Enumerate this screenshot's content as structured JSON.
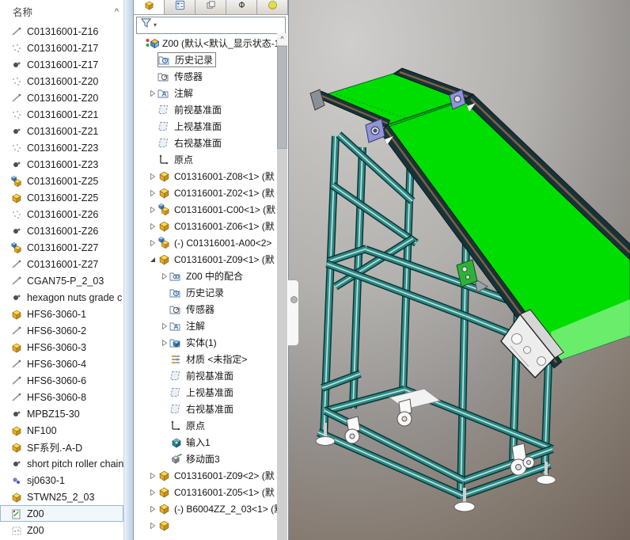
{
  "left_panel": {
    "header": "名称",
    "collapse_glyph": "^",
    "items": [
      {
        "label": "C01316001-Z16",
        "icon": "pin",
        "selected": false
      },
      {
        "label": "C01316001-Z17",
        "icon": "sketch",
        "selected": false
      },
      {
        "label": "C01316001-Z17",
        "icon": "dark",
        "selected": false
      },
      {
        "label": "C01316001-Z20",
        "icon": "sketch",
        "selected": false
      },
      {
        "label": "C01316001-Z20",
        "icon": "pin",
        "selected": false
      },
      {
        "label": "C01316001-Z21",
        "icon": "sketch",
        "selected": false
      },
      {
        "label": "C01316001-Z21",
        "icon": "dark",
        "selected": false
      },
      {
        "label": "C01316001-Z23",
        "icon": "sketch",
        "selected": false
      },
      {
        "label": "C01316001-Z23",
        "icon": "dark",
        "selected": false
      },
      {
        "label": "C01316001-Z25",
        "icon": "asm",
        "selected": false
      },
      {
        "label": "C01316001-Z25",
        "icon": "part",
        "selected": false
      },
      {
        "label": "C01316001-Z26",
        "icon": "sketch",
        "selected": false
      },
      {
        "label": "C01316001-Z26",
        "icon": "dark",
        "selected": false
      },
      {
        "label": "C01316001-Z27",
        "icon": "asm",
        "selected": false
      },
      {
        "label": "C01316001-Z27",
        "icon": "pin",
        "selected": false
      },
      {
        "label": "CGAN75-P_2_03",
        "icon": "pin",
        "selected": false
      },
      {
        "label": "hexagon nuts grade c",
        "icon": "dark",
        "selected": false
      },
      {
        "label": "HFS6-3060-1",
        "icon": "part",
        "selected": false
      },
      {
        "label": "HFS6-3060-2",
        "icon": "pin",
        "selected": false
      },
      {
        "label": "HFS6-3060-3",
        "icon": "part",
        "selected": false
      },
      {
        "label": "HFS6-3060-4",
        "icon": "pin",
        "selected": false
      },
      {
        "label": "HFS6-3060-6",
        "icon": "pin",
        "selected": false
      },
      {
        "label": "HFS6-3060-8",
        "icon": "pin",
        "selected": false
      },
      {
        "label": "MPBZ15-30",
        "icon": "dark",
        "selected": false
      },
      {
        "label": "NF100",
        "icon": "part",
        "selected": false
      },
      {
        "label": "SF系列.-A-D",
        "icon": "part",
        "selected": false
      },
      {
        "label": "short pitch roller chain",
        "icon": "dark",
        "selected": false
      },
      {
        "label": "sj0630-1",
        "icon": "blue",
        "selected": false
      },
      {
        "label": "STWN25_2_03",
        "icon": "part",
        "selected": false
      },
      {
        "label": "Z00",
        "icon": "z00g",
        "selected": true
      },
      {
        "label": "Z00",
        "icon": "z00d",
        "selected": false
      }
    ]
  },
  "feature_tree": {
    "tabs": [
      "featuremanager",
      "propertymanager",
      "configurationmanager",
      "dimxpertmanager",
      "displaymanager"
    ],
    "filter_caret": "▾",
    "scroll_up_glyph": "^",
    "items": [
      {
        "label": "Z00 (默认<默认_显示状态-1>",
        "icon": "root",
        "depth": 0,
        "arrow": "none",
        "boxed": false
      },
      {
        "label": "历史记录",
        "icon": "history",
        "depth": 1,
        "arrow": "none",
        "boxed": true
      },
      {
        "label": "传感器",
        "icon": "sensors",
        "depth": 1,
        "arrow": "none",
        "boxed": false
      },
      {
        "label": "注解",
        "icon": "annotations",
        "depth": 1,
        "arrow": "c",
        "boxed": false
      },
      {
        "label": "前视基准面",
        "icon": "plane",
        "depth": 1,
        "arrow": "none",
        "boxed": false
      },
      {
        "label": "上视基准面",
        "icon": "plane",
        "depth": 1,
        "arrow": "none",
        "boxed": false
      },
      {
        "label": "右视基准面",
        "icon": "plane",
        "depth": 1,
        "arrow": "none",
        "boxed": false
      },
      {
        "label": "原点",
        "icon": "origin",
        "depth": 1,
        "arrow": "none",
        "boxed": false
      },
      {
        "label": "C01316001-Z08<1> (默",
        "icon": "part",
        "depth": 1,
        "arrow": "c",
        "boxed": false
      },
      {
        "label": "C01316001-Z02<1> (默",
        "icon": "part",
        "depth": 1,
        "arrow": "c",
        "boxed": false
      },
      {
        "label": "C01316001-C00<1> (默",
        "icon": "asm",
        "depth": 1,
        "arrow": "c",
        "boxed": false
      },
      {
        "label": "C01316001-Z06<1> (默",
        "icon": "part",
        "depth": 1,
        "arrow": "c",
        "boxed": false
      },
      {
        "label": "(-) C01316001-A00<2>",
        "icon": "asm",
        "depth": 1,
        "arrow": "c",
        "boxed": false
      },
      {
        "label": "C01316001-Z09<1> (默",
        "icon": "part",
        "depth": 1,
        "arrow": "e",
        "boxed": false
      },
      {
        "label": "Z00 中的配合",
        "icon": "mates",
        "depth": 2,
        "arrow": "c",
        "boxed": false
      },
      {
        "label": "历史记录",
        "icon": "history",
        "depth": 2,
        "arrow": "none",
        "boxed": false
      },
      {
        "label": "传感器",
        "icon": "sensors",
        "depth": 2,
        "arrow": "none",
        "boxed": false
      },
      {
        "label": "注解",
        "icon": "annotations",
        "depth": 2,
        "arrow": "c",
        "boxed": false
      },
      {
        "label": "实体(1)",
        "icon": "bodies",
        "depth": 2,
        "arrow": "c",
        "boxed": false
      },
      {
        "label": "材质 <未指定>",
        "icon": "material",
        "depth": 2,
        "arrow": "none",
        "boxed": false
      },
      {
        "label": "前视基准面",
        "icon": "plane",
        "depth": 2,
        "arrow": "none",
        "boxed": false
      },
      {
        "label": "上视基准面",
        "icon": "plane",
        "depth": 2,
        "arrow": "none",
        "boxed": false
      },
      {
        "label": "右视基准面",
        "icon": "plane",
        "depth": 2,
        "arrow": "none",
        "boxed": false
      },
      {
        "label": "原点",
        "icon": "origin",
        "depth": 2,
        "arrow": "none",
        "boxed": false
      },
      {
        "label": "输入1",
        "icon": "imported",
        "depth": 2,
        "arrow": "none",
        "boxed": false
      },
      {
        "label": "移动面3",
        "icon": "moveface",
        "depth": 2,
        "arrow": "none",
        "boxed": false
      },
      {
        "label": "C01316001-Z09<2> (默",
        "icon": "part",
        "depth": 1,
        "arrow": "c",
        "boxed": false
      },
      {
        "label": "C01316001-Z05<1> (默",
        "icon": "part",
        "depth": 1,
        "arrow": "c",
        "boxed": false
      },
      {
        "label": "(-) B6004ZZ_2_03<1> (默",
        "icon": "part",
        "depth": 1,
        "arrow": "c",
        "boxed": false
      },
      {
        "label": "",
        "icon": "part",
        "depth": 1,
        "arrow": "c",
        "boxed": false
      }
    ]
  },
  "viewport": {
    "model": "inclined belt conveyor on aluminium extrusion cart with casters"
  },
  "colors": {
    "belt": "#00dd00",
    "belt_light": "#8df28d",
    "frame": "#2f8a86",
    "frame_dark": "#0c3534",
    "frame_light": "#bfe9e3",
    "rail_dark": "#15333a",
    "chain_brown": "#82603f",
    "bearing": "#9094d8",
    "motor": "#ededed",
    "sensor": "#2fb03a",
    "selection_border": "#9db8d2"
  }
}
